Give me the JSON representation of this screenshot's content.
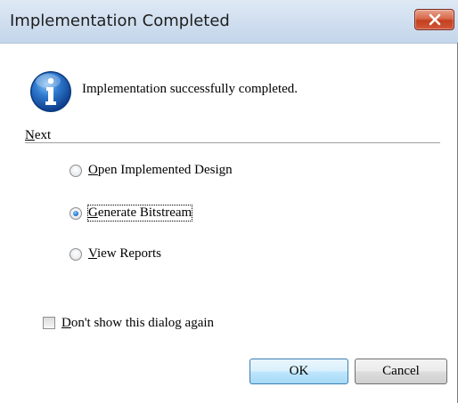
{
  "window": {
    "title": "Implementation Completed",
    "close_icon": "close-x-icon"
  },
  "info": {
    "icon": "info-icon",
    "message": "Implementation successfully completed."
  },
  "next_group": {
    "label_mnemonic": "N",
    "label_rest": "ext",
    "options": [
      {
        "mnemonic": "O",
        "rest": "pen Implemented Design",
        "checked": false
      },
      {
        "mnemonic": "G",
        "rest": "enerate Bitstream",
        "checked": true
      },
      {
        "mnemonic": "V",
        "rest": "iew Reports",
        "checked": false
      }
    ]
  },
  "dont_show": {
    "mnemonic": "D",
    "rest": "on't show this dialog again",
    "checked": false
  },
  "buttons": {
    "ok_label": "OK",
    "cancel_label": "Cancel"
  },
  "colors": {
    "title_bar": "#cfdeef",
    "close_button": "#c2401f",
    "ok_button_border": "#3c7fb1",
    "info_icon": "#1f5fb0"
  }
}
